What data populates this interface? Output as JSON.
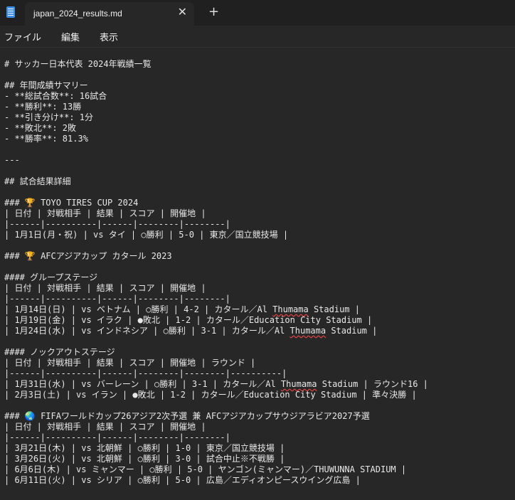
{
  "tab": {
    "title": "japan_2024_results.md"
  },
  "menu": {
    "file": "ファイル",
    "edit": "編集",
    "view": "表示"
  },
  "doc": {
    "lines": [
      "# サッカー日本代表 2024年戦績一覧",
      "",
      "## 年間成績サマリー",
      "- **総試合数**: 16試合",
      "- **勝利**: 13勝",
      "- **引き分け**: 1分",
      "- **敗北**: 2敗",
      "- **勝率**: 81.3%",
      "",
      "---",
      "",
      "## 試合結果詳細",
      "",
      "### 🏆 TOYO TIRES CUP 2024",
      "| 日付 | 対戦相手 | 結果 | スコア | 開催地 |",
      "|------|----------|------|--------|--------|",
      "| 1月1日(月・祝) | vs タイ | ○勝利 | 5-0 | 東京／国立競技場 |",
      "",
      "### 🏆 AFCアジアカップ カタール 2023",
      "",
      "#### グループステージ",
      "| 日付 | 対戦相手 | 結果 | スコア | 開催地 |",
      "|------|----------|------|--------|--------|",
      "| 1月14日(日) | vs ベトナム | ○勝利 | 4-2 | カタール／Al Thumama Stadium |",
      "| 1月19日(金) | vs イラク | ●敗北 | 1-2 | カタール／Education City Stadium |",
      "| 1月24日(水) | vs インドネシア | ○勝利 | 3-1 | カタール／Al Thumama Stadium |",
      "",
      "#### ノックアウトステージ",
      "| 日付 | 対戦相手 | 結果 | スコア | 開催地 | ラウンド |",
      "|------|----------|------|--------|--------|----------|",
      "| 1月31日(水) | vs バーレーン | ○勝利 | 3-1 | カタール／Al Thumama Stadium | ラウンド16 |",
      "| 2月3日(土) | vs イラン | ●敗北 | 1-2 | カタール／Education City Stadium | 準々決勝 |",
      "",
      "### 🌏 FIFAワールドカップ26アジア2次予選 兼 AFCアジアカップサウジアラビア2027予選",
      "| 日付 | 対戦相手 | 結果 | スコア | 開催地 |",
      "|------|----------|------|--------|--------|",
      "| 3月21日(木) | vs 北朝鮮 | ○勝利 | 1-0 | 東京／国立競技場 |",
      "| 3月26日(火) | vs 北朝鮮 | ○勝利 | 3-0 | 試合中止※不戦勝 |",
      "| 6月6日(木) | vs ミャンマー | ○勝利 | 5-0 | ヤンゴン(ミャンマー)／THUWUNNA STADIUM |",
      "| 6月11日(火) | vs シリア | ○勝利 | 5-0 | 広島／エディオンピースウイング広島 |"
    ]
  },
  "colors": {
    "background": "#272727",
    "titlebar": "#202020",
    "text": "#e8e8e8",
    "spellcheck": "#e04343"
  }
}
